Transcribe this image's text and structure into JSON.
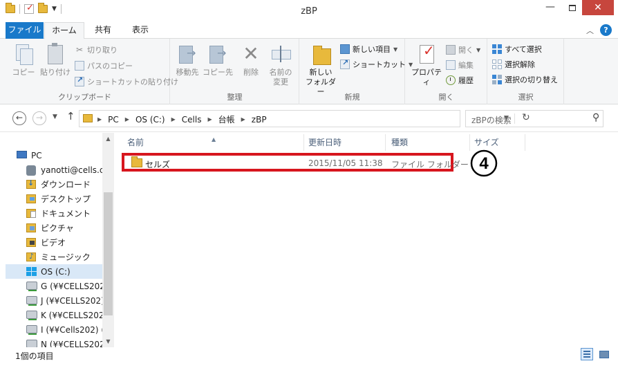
{
  "window": {
    "title": "zBP",
    "minimize_label": "—",
    "close_label": "✕"
  },
  "ribbon": {
    "tabs": [
      "ファイル",
      "ホーム",
      "共有",
      "表示"
    ],
    "active_tab": "ホーム",
    "help_label": "?",
    "collapse_label": "︿",
    "clipboard": {
      "group_label": "クリップボード",
      "copy": "コピー",
      "paste": "貼り付け",
      "cut": "切り取り",
      "copy_path": "パスのコピー",
      "paste_shortcut": "ショートカットの貼り付け"
    },
    "organize": {
      "group_label": "整理",
      "move_to": "移動先",
      "copy_to": "コピー先",
      "delete": "削除",
      "rename_line1": "名前の",
      "rename_line2": "変更"
    },
    "new": {
      "group_label": "新規",
      "new_folder_line1": "新しい",
      "new_folder_line2": "フォルダー",
      "new_item": "新しい項目",
      "easy_access": "ショートカット"
    },
    "open": {
      "group_label": "開く",
      "properties": "プロパティ",
      "open": "開く",
      "edit": "編集",
      "history": "履歴"
    },
    "select": {
      "group_label": "選択",
      "select_all": "すべて選択",
      "select_none": "選択解除",
      "invert_selection": "選択の切り替え"
    }
  },
  "address": {
    "breadcrumb": [
      "PC",
      "OS (C:)",
      "Cells",
      "台帳",
      "zBP"
    ],
    "search_placeholder": "zBPの検索"
  },
  "nav_pane": {
    "items": [
      {
        "label": "PC",
        "icon": "pc-icon"
      },
      {
        "label": "yanotti@cells.c",
        "icon": "user-folder-icon"
      },
      {
        "label": "ダウンロード",
        "icon": "downloads-folder-icon"
      },
      {
        "label": "デスクトップ",
        "icon": "desktop-folder-icon"
      },
      {
        "label": "ドキュメント",
        "icon": "documents-folder-icon"
      },
      {
        "label": "ピクチャ",
        "icon": "pictures-folder-icon"
      },
      {
        "label": "ビデオ",
        "icon": "videos-folder-icon"
      },
      {
        "label": "ミュージック",
        "icon": "music-folder-icon"
      },
      {
        "label": "OS (C:)",
        "icon": "drive-icon",
        "selected": true
      },
      {
        "label": "G (¥¥CELLS202",
        "icon": "network-drive-icon"
      },
      {
        "label": "J (¥¥CELLS202)",
        "icon": "network-drive-icon"
      },
      {
        "label": "K (¥¥CELLS202",
        "icon": "network-drive-icon"
      },
      {
        "label": "I (¥¥Cells202) (",
        "icon": "network-drive-icon"
      },
      {
        "label": "N (¥¥CELLS202",
        "icon": "network-drive-icon"
      }
    ]
  },
  "file_list": {
    "columns": [
      "名前",
      "更新日時",
      "種類",
      "サイズ"
    ],
    "rows": [
      {
        "name": "セルズ",
        "modified": "2015/11/05 11:38",
        "type": "ファイル フォルダー",
        "size": ""
      }
    ],
    "annotation_marker": "④",
    "highlight_color": "#d7161e"
  },
  "status": {
    "item_count": "1個の項目"
  },
  "colors": {
    "accent": "#1979ca",
    "close": "#c7463d",
    "selected": "#d9e8f7"
  }
}
